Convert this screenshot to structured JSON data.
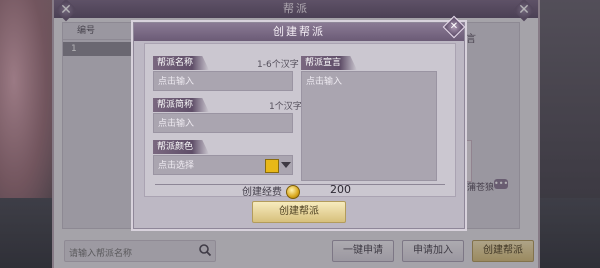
{
  "window": {
    "title": "帮派"
  },
  "list": {
    "header": "编号",
    "rows": [
      "1"
    ]
  },
  "side": {
    "declare_tab": "言",
    "name_partial": "蒲苍狼"
  },
  "search": {
    "placeholder": "请输入帮派名称"
  },
  "buttons": {
    "one_key_apply": "一键申请",
    "apply_join": "申请加入",
    "create_guild": "创建帮派"
  },
  "dialog": {
    "title": "创建帮派",
    "name_label": "帮派名称",
    "name_hint": "1-6个汉字",
    "name_placeholder": "点击输入",
    "abbr_label": "帮派简称",
    "abbr_hint": "1个汉字",
    "abbr_placeholder": "点击输入",
    "color_label": "帮派颜色",
    "color_placeholder": "点击选择",
    "declare_label": "帮派宣言",
    "declare_placeholder": "点击输入",
    "cost_label": "创建经费",
    "cost_value": "200",
    "create_button": "创建帮派"
  },
  "colors": {
    "swatch": "#e8b818",
    "gold_button": "#d8c07b"
  }
}
